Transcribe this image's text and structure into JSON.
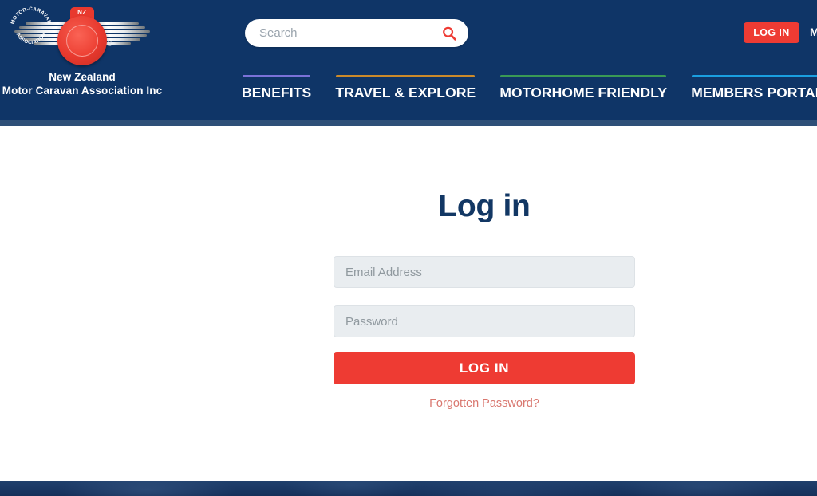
{
  "header": {
    "background_color": "#0f3567",
    "logo": {
      "badge_top_text": "NZ",
      "badge_arc_top": "MOTOR-CARAVAN",
      "badge_arc_bottom": "ASSOCIATION",
      "registered_mark": "®",
      "line1": "New Zealand",
      "line2": "Motor Caravan Association Inc"
    },
    "search": {
      "placeholder": "Search",
      "value": "",
      "icon": "search-icon",
      "icon_color": "#ee3b33"
    },
    "top_login_label": "LOG IN",
    "top_login_color": "#ee3b33",
    "top_extra_label": "M",
    "nav": [
      {
        "label": "BENEFITS",
        "rule_color": "#7b72d8"
      },
      {
        "label": "TRAVEL & EXPLORE",
        "rule_color": "#cc8a2a"
      },
      {
        "label": "MOTORHOME FRIENDLY",
        "rule_color": "#3a9a55"
      },
      {
        "label": "MEMBERS PORTAL",
        "rule_color": "#1a9fe0"
      }
    ]
  },
  "main": {
    "title": "Log in",
    "title_color": "#123764",
    "email": {
      "placeholder": "Email Address",
      "value": ""
    },
    "password": {
      "placeholder": "Password",
      "value": ""
    },
    "submit_label": "LOG IN",
    "submit_color": "#ee3b33",
    "forgot_label": "Forgotten Password?",
    "forgot_color": "#d9776f"
  },
  "footer": {
    "background_color": "#1a3763"
  }
}
